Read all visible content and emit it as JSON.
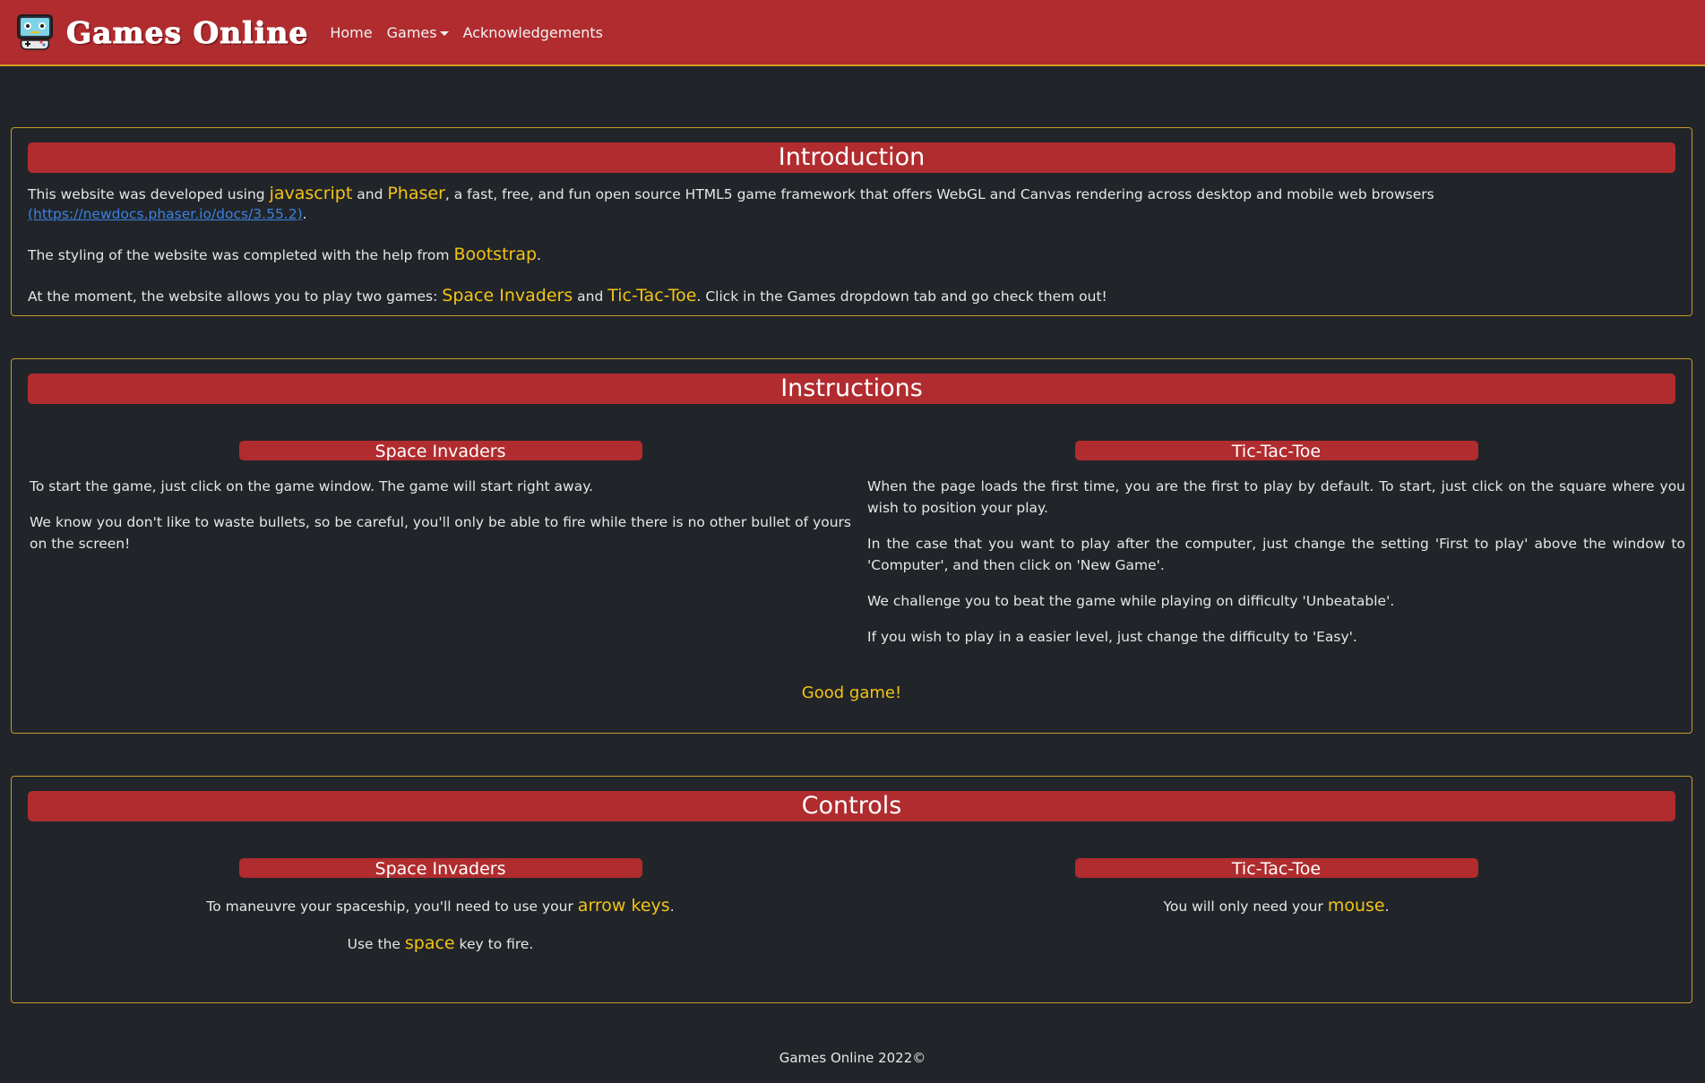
{
  "nav": {
    "brand": "Games Online",
    "links": [
      "Home",
      "Games",
      "Acknowledgements"
    ]
  },
  "intro": {
    "title": "Introduction",
    "p1": {
      "t1": "This website was developed using ",
      "h1": "javascript",
      "t2": " and ",
      "h2": "Phaser",
      "t3": ", a fast, free, and fun open source HTML5 game framework that offers WebGL and Canvas rendering across desktop and mobile web browsers ",
      "link": "(https://newdocs.phaser.io/docs/3.55.2)",
      "t4": "."
    },
    "p2": {
      "t1": "The styling of the website was completed with the help from ",
      "h1": "Bootstrap",
      "t2": "."
    },
    "p3": {
      "t1": "At the moment, the website allows you to play two games: ",
      "h1": "Space Invaders",
      "t2": " and ",
      "h2": "Tic-Tac-Toe",
      "t3": ". Click in the Games dropdown tab and go check them out!"
    }
  },
  "instructions": {
    "title": "Instructions",
    "left": {
      "title": "Space Invaders",
      "p1": "To start the game, just click on the game window. The game will start right away.",
      "p2": "We know you don't like to waste bullets, so be careful, you'll only be able to fire while there is no other bullet of yours on the screen!"
    },
    "right": {
      "title": "Tic-Tac-Toe",
      "p1": "When the page loads the first time, you are the first to play by default. To start, just click on the square where you wish to position your play.",
      "p2": "In the case that you want to play after the computer, just change the setting 'First to play' above the window to 'Computer', and then click on 'New Game'.",
      "p3": "We challenge you to beat the game while playing on difficulty 'Unbeatable'.",
      "p4": "If you wish to play in a easier level, just change the difficulty to 'Easy'."
    },
    "closing": "Good game!"
  },
  "controls": {
    "title": "Controls",
    "left": {
      "title": "Space Invaders",
      "p1": {
        "t1": "To maneuvre your spaceship, you'll need to use your ",
        "h1": "arrow keys",
        "t2": "."
      },
      "p2": {
        "t1": "Use the ",
        "h1": "space",
        "t2": " key to fire."
      }
    },
    "right": {
      "title": "Tic-Tac-Toe",
      "p1": {
        "t1": "You will only need your ",
        "h1": "mouse",
        "t2": "."
      }
    }
  },
  "footer": "Games Online 2022©",
  "colors": {
    "background": "#212529",
    "accent_red": "#b02c2f",
    "highlight": "#f3c318",
    "border_gold": "#c8992a",
    "link": "#3b82e0"
  },
  "icons": {
    "logo": "gamepad-robot-icon",
    "dropdown": "caret-down-icon"
  }
}
